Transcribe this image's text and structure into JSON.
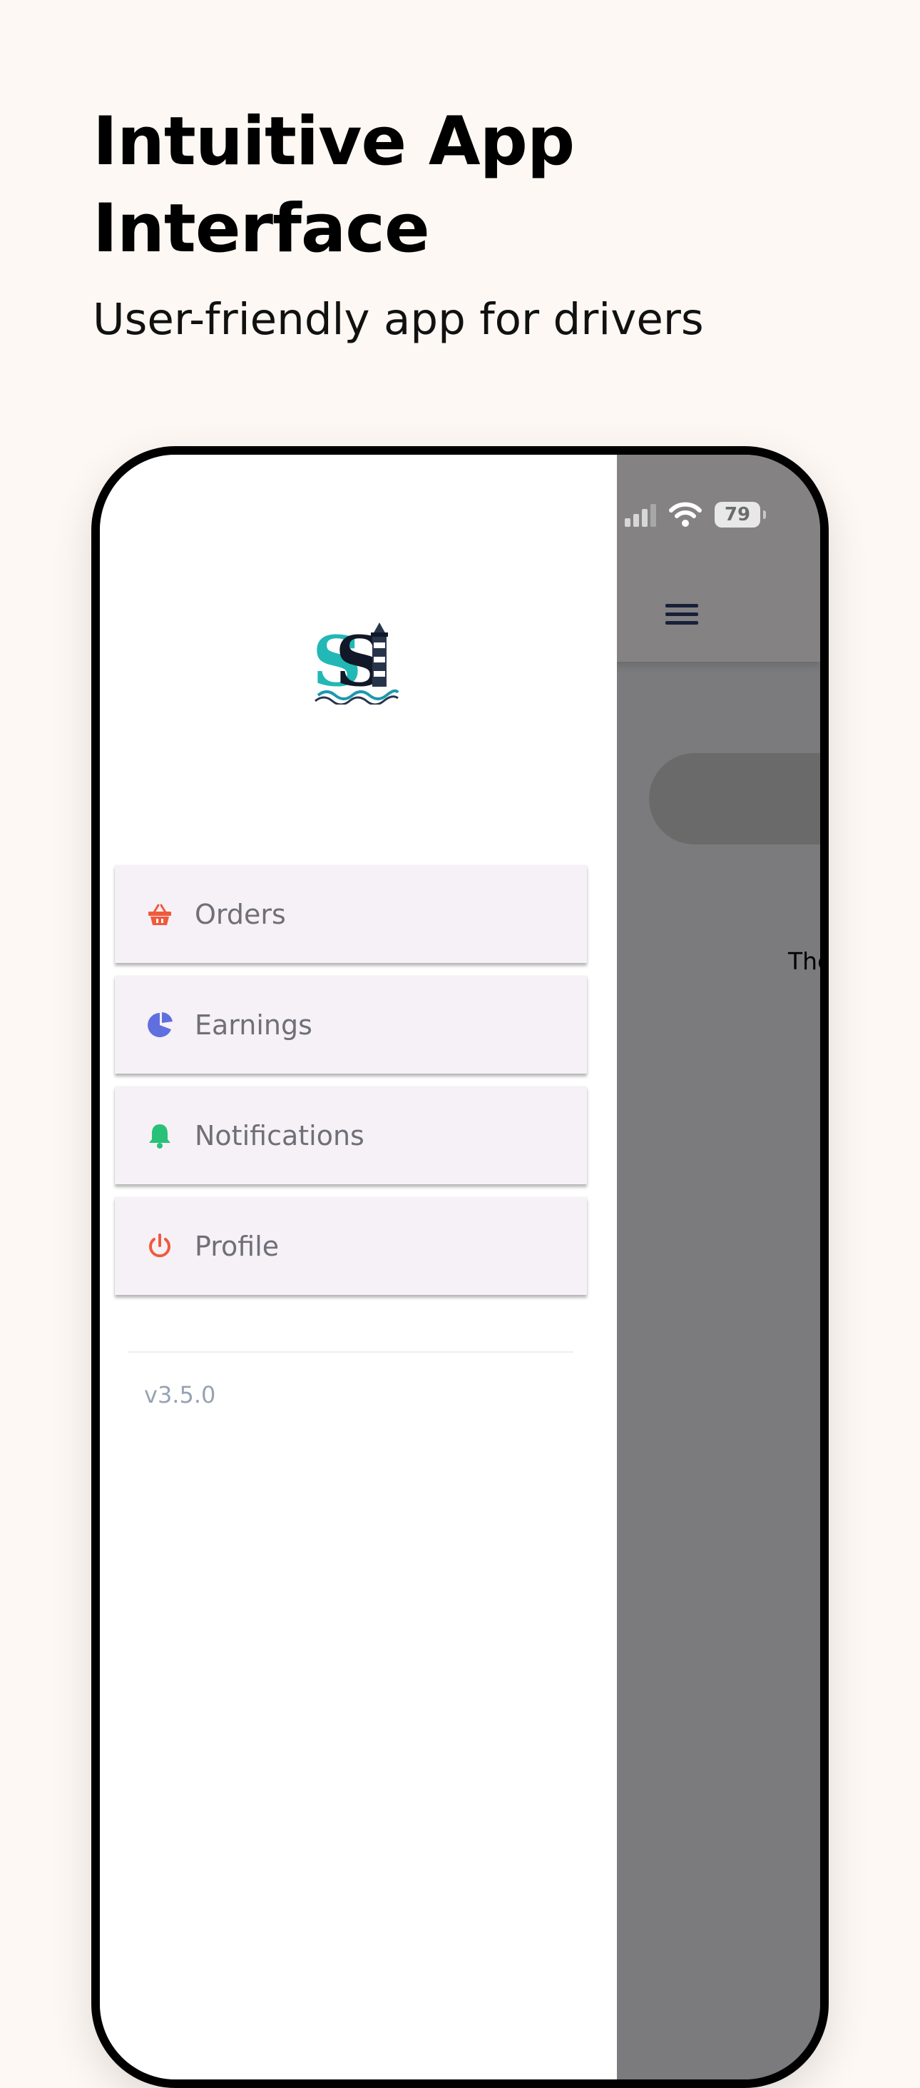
{
  "page": {
    "headline": "Intuitive App Interface",
    "subheadline": "User-friendly app for drivers"
  },
  "status_bar": {
    "battery": "79",
    "icons": [
      "cellular-signal-icon",
      "wifi-icon",
      "battery-icon"
    ]
  },
  "drawer": {
    "logo": "SS lighthouse logo",
    "items": [
      {
        "label": "Orders",
        "icon": "basket-icon",
        "color": "#f05a3c"
      },
      {
        "label": "Earnings",
        "icon": "pie-chart-icon",
        "color": "#5f6fe0"
      },
      {
        "label": "Notifications",
        "icon": "bell-icon",
        "color": "#27c277"
      },
      {
        "label": "Profile",
        "icon": "power-icon",
        "color": "#f05a3c"
      }
    ],
    "version": "v3.5.0"
  },
  "background_screen": {
    "text": "The"
  }
}
